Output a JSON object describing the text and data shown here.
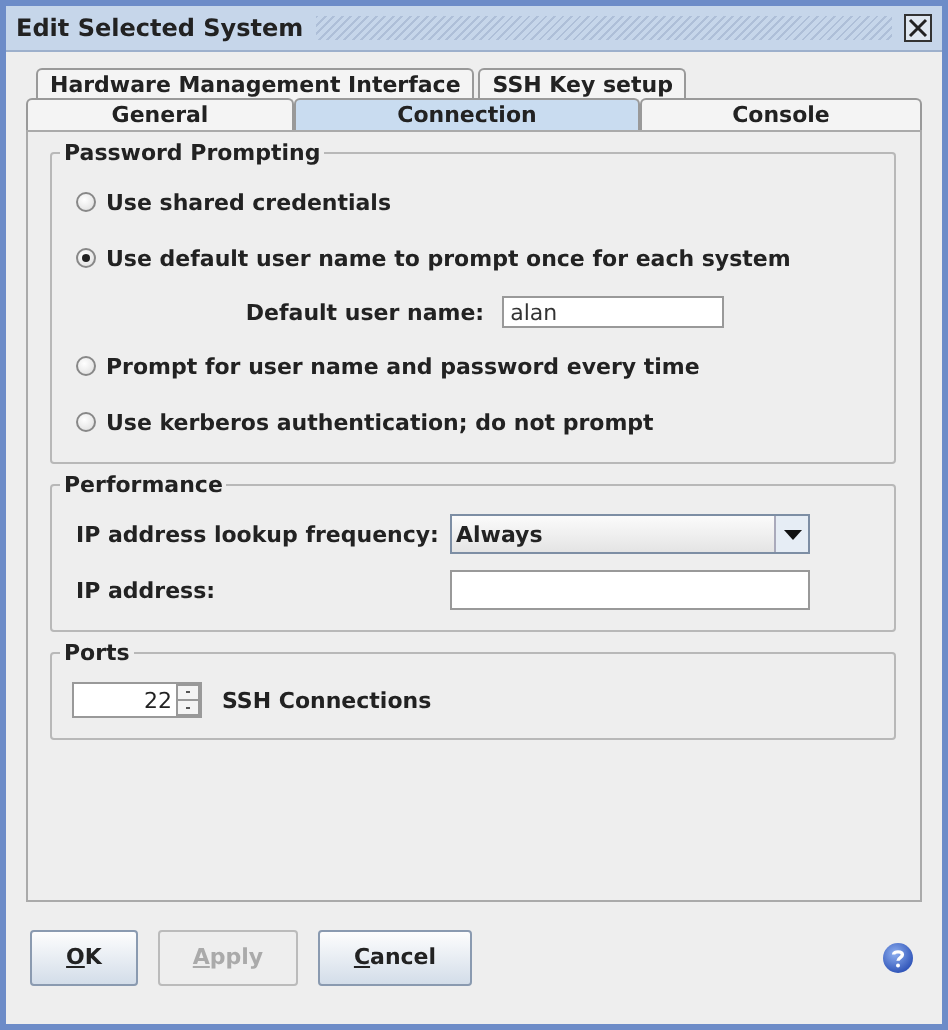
{
  "window": {
    "title": "Edit Selected System"
  },
  "tab_rows": [
    [
      {
        "label": "Hardware Management Interface",
        "selected": false
      },
      {
        "label": "SSH Key setup",
        "selected": false
      }
    ],
    [
      {
        "label": "General",
        "selected": false
      },
      {
        "label": "Connection",
        "selected": true
      },
      {
        "label": "Console",
        "selected": false
      }
    ]
  ],
  "password_prompting": {
    "title": "Password Prompting",
    "options": [
      {
        "label": "Use shared credentials",
        "selected": false
      },
      {
        "label": "Use default user name to prompt once for each system",
        "selected": true
      },
      {
        "label": "Prompt for user name and password every time",
        "selected": false
      },
      {
        "label": "Use kerberos authentication; do not prompt",
        "selected": false
      }
    ],
    "default_user": {
      "label": "Default user name:",
      "value": "alan"
    }
  },
  "performance": {
    "title": "Performance",
    "lookup": {
      "label": "IP address lookup frequency:",
      "value": "Always"
    },
    "ip_address": {
      "label": "IP address:"
    }
  },
  "ports": {
    "title": "Ports",
    "ssh": {
      "value": "22",
      "label": "SSH Connections"
    }
  },
  "buttons": [
    {
      "label": "OK",
      "disabled": false
    },
    {
      "label": "Apply",
      "disabled": true
    },
    {
      "label": "Cancel",
      "disabled": false
    }
  ]
}
